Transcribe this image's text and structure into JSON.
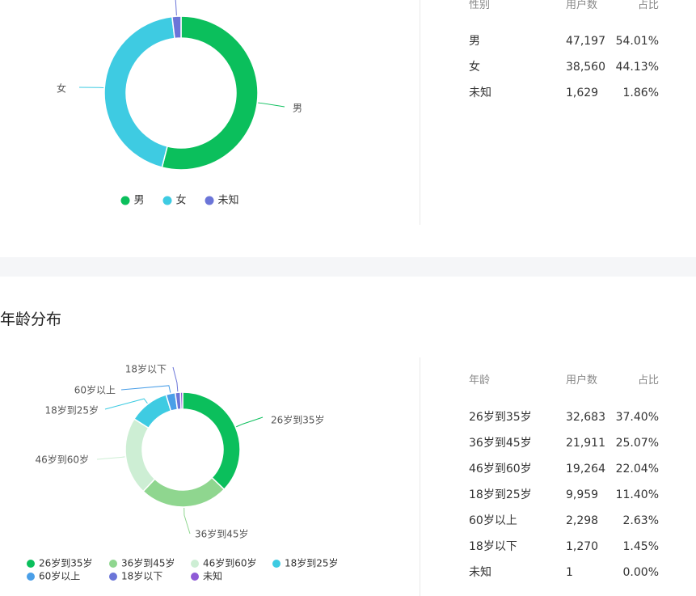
{
  "gender": {
    "table_headers": [
      "性别",
      "用户数",
      "占比"
    ],
    "rows": [
      {
        "label": "男",
        "users": "47,197",
        "share": "54.01%"
      },
      {
        "label": "女",
        "users": "38,560",
        "share": "44.13%"
      },
      {
        "label": "未知",
        "users": "1,629",
        "share": "1.86%"
      }
    ]
  },
  "age": {
    "title": "年龄分布",
    "table_headers": [
      "年龄",
      "用户数",
      "占比"
    ],
    "rows": [
      {
        "label": "26岁到35岁",
        "users": "32,683",
        "share": "37.40%"
      },
      {
        "label": "36岁到45岁",
        "users": "21,911",
        "share": "25.07%"
      },
      {
        "label": "46岁到60岁",
        "users": "19,264",
        "share": "22.04%"
      },
      {
        "label": "18岁到25岁",
        "users": "9,959",
        "share": "11.40%"
      },
      {
        "label": "60岁以上",
        "users": "2,298",
        "share": "2.63%"
      },
      {
        "label": "18岁以下",
        "users": "1,270",
        "share": "1.45%"
      },
      {
        "label": "未知",
        "users": "1",
        "share": "0.00%"
      }
    ]
  },
  "chart_data": [
    {
      "type": "pie",
      "title": "",
      "categories": [
        "男",
        "女",
        "未知"
      ],
      "values": [
        47197,
        38560,
        1629
      ],
      "percent": [
        54.01,
        44.13,
        1.86
      ],
      "colors": [
        "#0bbf5c",
        "#3ecbe2",
        "#6b75d8"
      ],
      "donut": true,
      "legend": "bottom"
    },
    {
      "type": "pie",
      "title": "年龄分布",
      "categories": [
        "26岁到35岁",
        "36岁到45岁",
        "46岁到60岁",
        "18岁到25岁",
        "60岁以上",
        "18岁以下",
        "未知"
      ],
      "values": [
        32683,
        21911,
        19264,
        9959,
        2298,
        1270,
        1
      ],
      "percent": [
        37.4,
        25.07,
        22.04,
        11.4,
        2.63,
        1.45,
        0.0
      ],
      "colors": [
        "#0bbf5c",
        "#8fd68f",
        "#cdeed4",
        "#3ecbe2",
        "#4a9fe8",
        "#6b75d8",
        "#8e5bd6"
      ],
      "donut": true,
      "legend": "bottom"
    }
  ]
}
